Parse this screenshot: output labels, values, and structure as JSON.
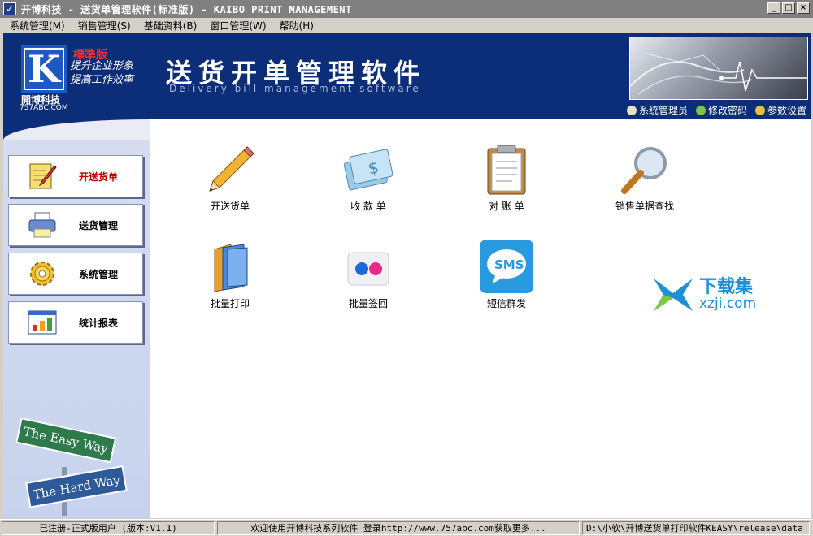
{
  "window": {
    "title": "开博科技 - 送货单管理软件(标准版) - KAIBO PRINT MANAGEMENT",
    "controls": [
      "_",
      "□",
      "×"
    ]
  },
  "menu": [
    "系统管理(M)",
    "销售管理(S)",
    "基础资料(B)",
    "窗口管理(W)",
    "帮助(H)"
  ],
  "banner": {
    "logo_letter": "K",
    "edition": "標準版",
    "slogan_line1": "提升企业形象",
    "slogan_line2": "提高工作效率",
    "company": "開博科技",
    "site": "757ABC.COM",
    "title": "送货开单管理软件",
    "subtitle": "Delivery bill management software",
    "links": [
      {
        "label": "系统管理员",
        "icon": "user-icon"
      },
      {
        "label": "修改密码",
        "icon": "pencil-icon"
      },
      {
        "label": "参数设置",
        "icon": "globe-icon"
      }
    ]
  },
  "sidebar": {
    "items": [
      {
        "label": "开送货单",
        "icon": "note-pencil-icon",
        "active": true
      },
      {
        "label": "送货管理",
        "icon": "printer-icon",
        "active": false
      },
      {
        "label": "系统管理",
        "icon": "gear-icon",
        "active": false
      },
      {
        "label": "统计报表",
        "icon": "bar-chart-icon",
        "active": false
      }
    ],
    "signs": {
      "top": "The Easy Way",
      "bottom": "The Hard Way"
    }
  },
  "tiles": [
    {
      "label": "开送货单",
      "icon": "pencil-icon"
    },
    {
      "label": "收 款 单",
      "icon": "money-card-icon"
    },
    {
      "label": "对 账 单",
      "icon": "clipboard-icon"
    },
    {
      "label": "销售单据查找",
      "icon": "magnifier-icon"
    },
    {
      "label": "批量打印",
      "icon": "folders-icon"
    },
    {
      "label": "批量签回",
      "icon": "flickr-dots-icon"
    },
    {
      "label": "短信群发",
      "icon": "sms-icon"
    }
  ],
  "watermark": {
    "cn": "下载集",
    "en": "xzji.com"
  },
  "status": {
    "user": "已注册-正式版用户 (版本:V1.1)",
    "welcome": "欢迎使用开博科技系列软件  登录http://www.757abc.com获取更多...",
    "path": "D:\\小软\\开博送货单打印软件KEASY\\release\\data"
  },
  "colors": {
    "banner_bg": "#0c2d78",
    "active_nav_text": "#c00000",
    "watermark": "#1e90d4"
  }
}
